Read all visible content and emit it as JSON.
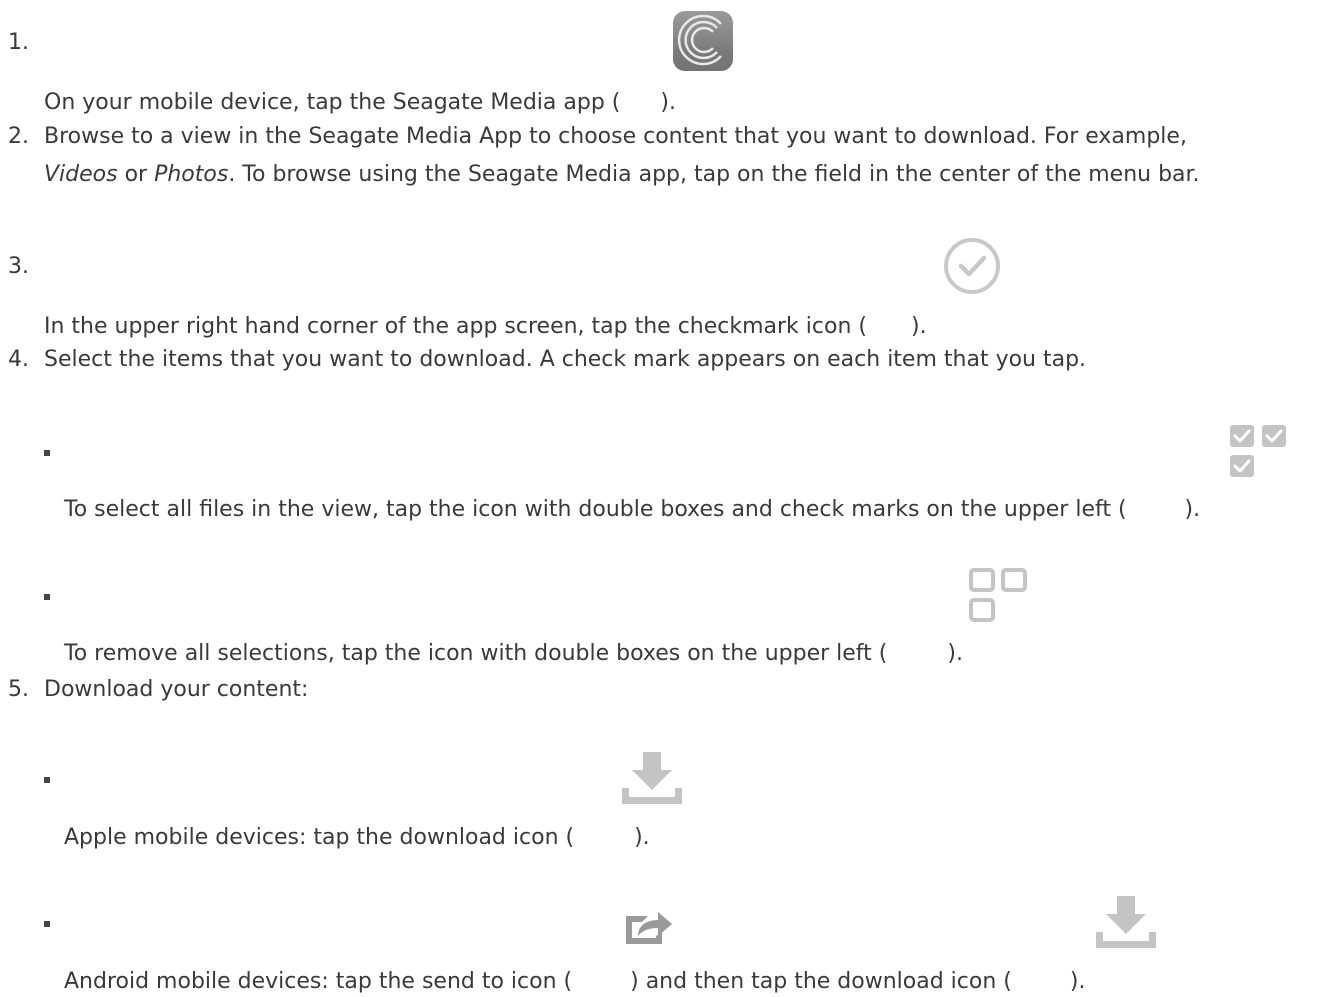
{
  "steps": [
    {
      "number": "1.",
      "text": "On your mobile device, tap the Seagate Media app (",
      "text_end": ")."
    },
    {
      "number": "2.",
      "line1": "Browse to a view in the Seagate Media App to choose content that you want to download. For example,",
      "line2_em1": "Videos",
      "line2_or": " or ",
      "line2_em2": "Photos",
      "line2_rest": ". To browse using the Seagate Media app, tap on the field in the center of the menu bar."
    },
    {
      "number": "3.",
      "text": "In the upper right hand corner of the app screen, tap the checkmark icon (",
      "text_end": ")."
    },
    {
      "number": "4.",
      "text": "Select the items that you want to download. A check mark appears on each item that you tap.",
      "subitems": [
        {
          "text": "To select all files in the view, tap the icon with double boxes and check marks on the upper left (",
          "text_end": ")."
        },
        {
          "text": "To remove all selections, tap the icon with double boxes on the upper left (",
          "text_end": ")."
        }
      ]
    },
    {
      "number": "5.",
      "text": "Download your content:",
      "subitems": [
        {
          "text": "Apple mobile devices: tap the download icon (",
          "text_end": ")."
        },
        {
          "text": "Android mobile devices: tap the send to icon (",
          "text_mid": ") and then tap the download icon (",
          "text_end": ")."
        }
      ]
    }
  ],
  "icons": {
    "app": "seagate-media-app-icon",
    "checkmark": "checkmark-circle-icon",
    "select_all": "select-all-icon",
    "deselect_all": "deselect-all-icon",
    "download": "download-icon",
    "send_to": "send-to-icon"
  },
  "colors": {
    "text": "#3a3a3a",
    "icon_gray": "#bdbdbd",
    "app_icon": "#8a8a8a"
  }
}
